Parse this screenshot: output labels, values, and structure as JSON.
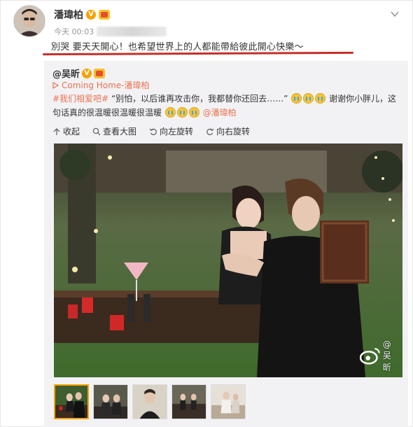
{
  "post": {
    "author": "潘瑋柏",
    "verified_badge": "V",
    "time": "今天 00:03",
    "text": "別哭 要天天開心！也希望世界上的人都能帶給彼此開心快樂～"
  },
  "repost": {
    "author": "@吴昕",
    "verified_badge": "V",
    "link_text": "Coming Home-潘瑋柏",
    "tag": "#我们相爱吧#",
    "body_1": "“别怕，以后谁再攻击你，我都替你还回去……”",
    "body_2": "谢谢你小胖儿，这句话真的很温暖很温暖很温暖",
    "mention": "@潘瑋柏",
    "actions": {
      "collapse": "收起",
      "view_large": "查看大图",
      "rotate_left": "向左旋转",
      "rotate_right": "向右旋转"
    },
    "watermark": "@吴昕"
  },
  "colors": {
    "accent": "#eb7350",
    "badge": "#f7a100",
    "underline": "#c4302b"
  }
}
